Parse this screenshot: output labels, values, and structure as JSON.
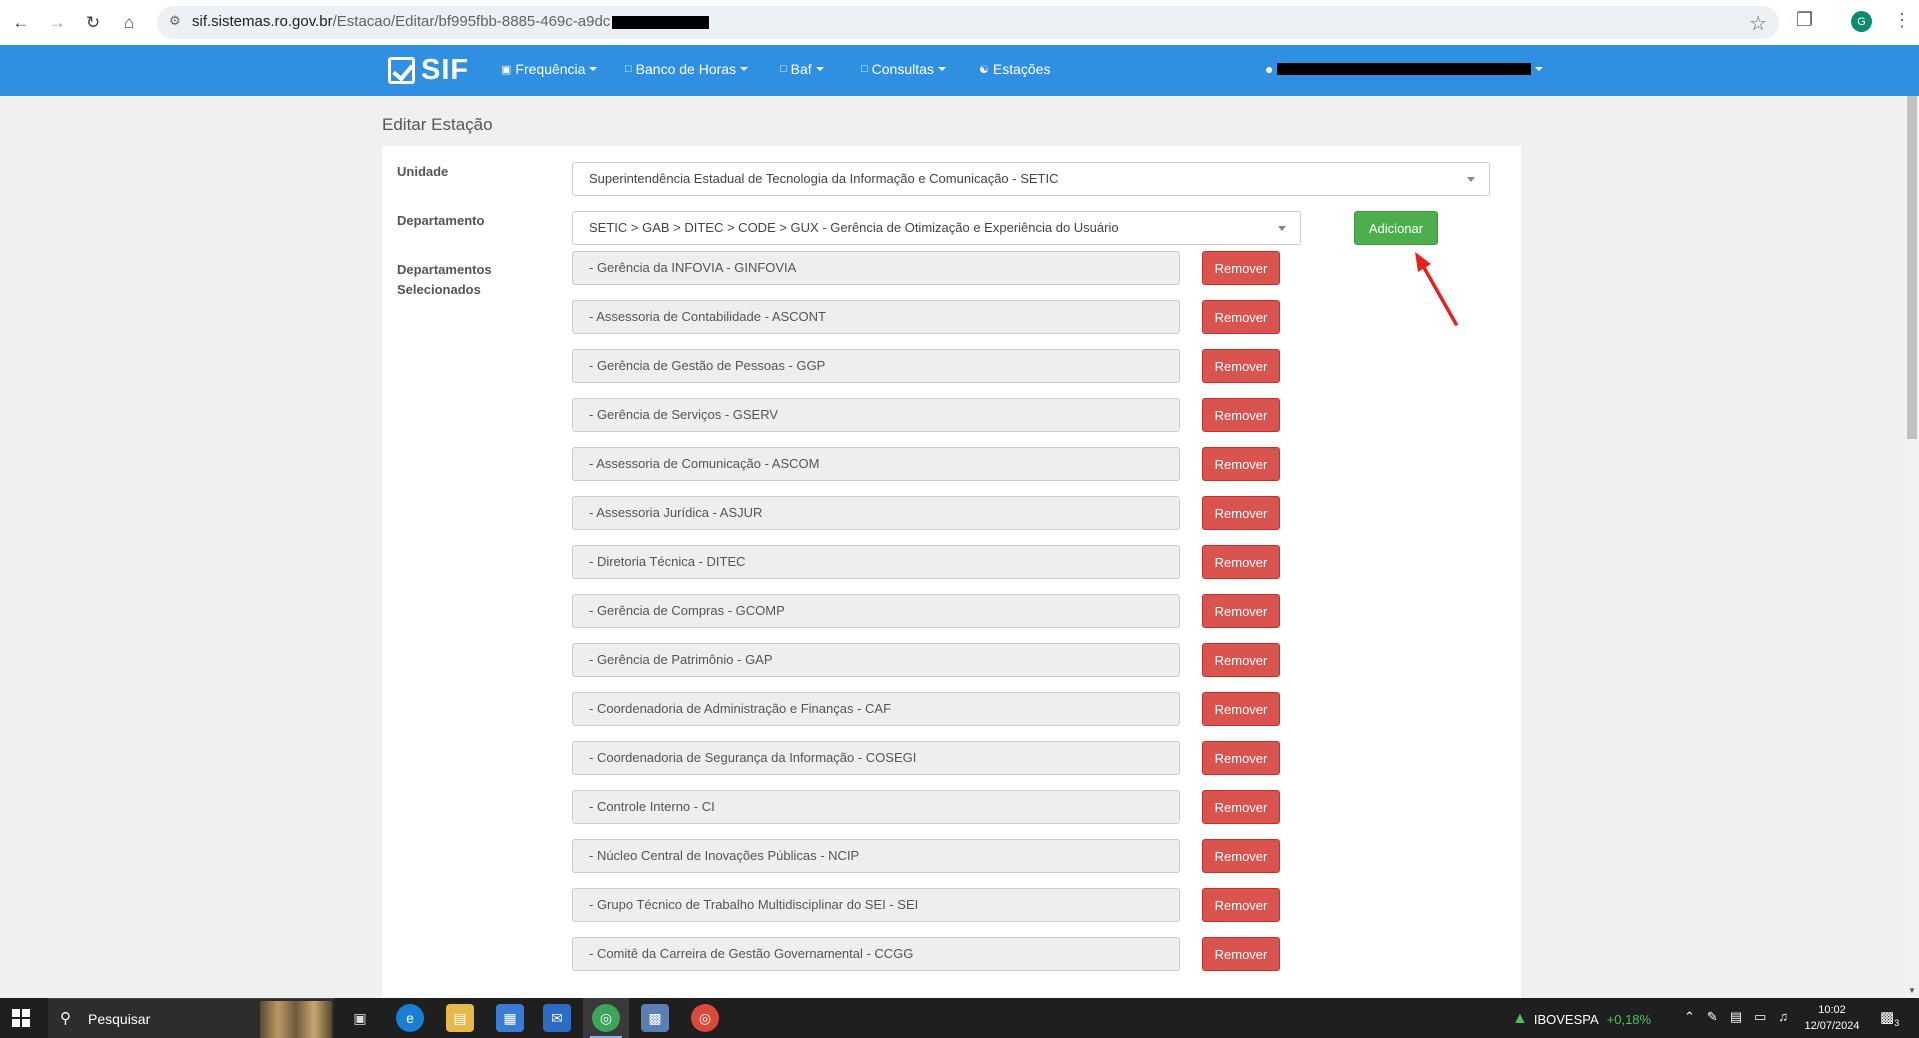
{
  "browser": {
    "url_host": "sif.sistemas.ro.gov.br",
    "url_path": "/Estacao/Editar/bf995fbb-8885-469c-a9dc",
    "profile_initial": "G"
  },
  "navbar": {
    "brand": "SIF",
    "items": [
      {
        "label": "Frequência",
        "icon": "calendar-icon",
        "dropdown": true
      },
      {
        "label": "Banco de Horas",
        "icon": "file-icon",
        "dropdown": true
      },
      {
        "label": "Baf",
        "icon": "file-icon",
        "dropdown": true
      },
      {
        "label": "Consultas",
        "icon": "file-icon",
        "dropdown": true
      },
      {
        "label": "Estações",
        "icon": "group-icon",
        "dropdown": false
      }
    ]
  },
  "page": {
    "title": "Editar Estação",
    "unidade_label": "Unidade",
    "unidade_value": "Superintendência Estadual de Tecnologia da Informação e Comunicação - SETIC",
    "departamento_label": "Departamento",
    "departamento_value": "SETIC > GAB > DITEC > CODE > GUX - Gerência de Otimização e Experiência do Usuário",
    "add_button": "Adicionar",
    "selected_label_1": "Departamentos",
    "selected_label_2": "Selecionados",
    "remove_button": "Remover",
    "selected_departments": [
      "- Gerência da INFOVIA - GINFOVIA",
      "- Assessoria de Contabilidade - ASCONT",
      "- Gerência de Gestão de Pessoas - GGP",
      "- Gerência de Serviços - GSERV",
      "- Assessoria de Comunicação - ASCOM",
      "- Assessoria Jurídica - ASJUR",
      "- Diretoria Técnica - DITEC",
      "- Gerência de Compras - GCOMP",
      "- Gerência de Patrimônio - GAP",
      "- Coordenadoria de Administração e Finanças - CAF",
      "- Coordenadoria de Segurança da Informação - COSEGI",
      "- Controle Interno - CI",
      "- Núcleo Central de Inovações Públicas - NCIP",
      "- Grupo Técnico de Trabalho Multidisciplinar do SEI - SEI",
      "- Comitê da Carreira de Gestão Governamental - CCGG"
    ]
  },
  "taskbar": {
    "search_placeholder": "Pesquisar",
    "ticker_name": "IBOVESPA",
    "ticker_change": "+0,18%",
    "time": "10:02",
    "date": "12/07/2024",
    "notification_count": "3"
  },
  "colors": {
    "navbar": "#2f8fe0",
    "add": "#4cae4c",
    "remove": "#d9534f"
  }
}
